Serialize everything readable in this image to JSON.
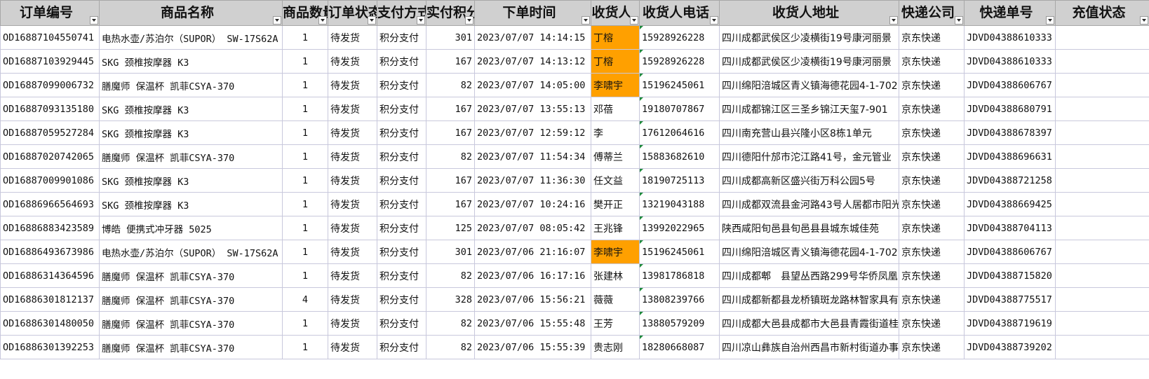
{
  "headers": {
    "order_no": "订单编号",
    "product": "商品名称",
    "qty": "商品数量",
    "status": "订单状态",
    "pay": "支付方式",
    "points": "实付积分",
    "time": "下单时间",
    "name": "收货人",
    "phone": "收货人电话",
    "addr": "收货人地址",
    "courier": "快递公司",
    "tracking": "快递单号",
    "recharge": "充值状态"
  },
  "highlight_color": "#ffa000",
  "rows": [
    {
      "order_no": "OD16887104550741",
      "product": "电热水壶/苏泊尔（SUPOR） SW-17S62A",
      "qty": "1",
      "status": "待发货",
      "pay": "积分支付",
      "points": "301",
      "time": "2023/07/07 14:14:15",
      "name": "丁榕",
      "phone": "15928926228",
      "addr": "四川成都武侯区少凌横街19号康河丽景",
      "courier": "京东快递",
      "tracking": "JDVD04388610333",
      "recharge": "",
      "highlight": true
    },
    {
      "order_no": "OD16887103929445",
      "product": "SKG 颈椎按摩器 K3",
      "qty": "1",
      "status": "待发货",
      "pay": "积分支付",
      "points": "167",
      "time": "2023/07/07 14:13:12",
      "name": "丁榕",
      "phone": "15928926228",
      "addr": "四川成都武侯区少凌横街19号康河丽景",
      "courier": "京东快递",
      "tracking": "JDVD04388610333",
      "recharge": "",
      "highlight": true
    },
    {
      "order_no": "OD16887099006732",
      "product": "膳魔师 保温杯 凯菲CSYA-370",
      "qty": "1",
      "status": "待发货",
      "pay": "积分支付",
      "points": "82",
      "time": "2023/07/07 14:05:00",
      "name": "李啸宇",
      "phone": "15196245061",
      "addr": "四川绵阳涪城区青义镇海德花园4-1-702",
      "courier": "京东快递",
      "tracking": "JDVD04388606767",
      "recharge": "",
      "highlight": true
    },
    {
      "order_no": "OD16887093135180",
      "product": "SKG 颈椎按摩器 K3",
      "qty": "1",
      "status": "待发货",
      "pay": "积分支付",
      "points": "167",
      "time": "2023/07/07 13:55:13",
      "name": "邓蓓",
      "phone": "19180707867",
      "addr": "四川成都锦江区三圣乡锦江天玺7-901",
      "courier": "京东快递",
      "tracking": "JDVD04388680791",
      "recharge": "",
      "highlight": false
    },
    {
      "order_no": "OD16887059527284",
      "product": "SKG 颈椎按摩器 K3",
      "qty": "1",
      "status": "待发货",
      "pay": "积分支付",
      "points": "167",
      "time": "2023/07/07 12:59:12",
      "name": "李",
      "phone": "17612064616",
      "addr": "四川南充营山县兴隆小区8栋1单元",
      "courier": "京东快递",
      "tracking": "JDVD04388678397",
      "recharge": "",
      "highlight": false
    },
    {
      "order_no": "OD16887020742065",
      "product": "膳魔师 保温杯 凯菲CSYA-370",
      "qty": "1",
      "status": "待发货",
      "pay": "积分支付",
      "points": "82",
      "time": "2023/07/07 11:54:34",
      "name": "傅蒂兰",
      "phone": "15883682610",
      "addr": "四川德阳什邡市沱江路41号，金元管业",
      "courier": "京东快递",
      "tracking": "JDVD04388696631",
      "recharge": "",
      "highlight": false
    },
    {
      "order_no": "OD16887009901086",
      "product": "SKG 颈椎按摩器 K3",
      "qty": "1",
      "status": "待发货",
      "pay": "积分支付",
      "points": "167",
      "time": "2023/07/07 11:36:30",
      "name": "任文益",
      "phone": "18190725113",
      "addr": "四川成都高新区盛兴街万科公园5号",
      "courier": "京东快递",
      "tracking": "JDVD04388721258",
      "recharge": "",
      "highlight": false
    },
    {
      "order_no": "OD16886966564693",
      "product": "SKG 颈椎按摩器 K3",
      "qty": "1",
      "status": "待发货",
      "pay": "积分支付",
      "points": "167",
      "time": "2023/07/07 10:24:16",
      "name": "樊开正",
      "phone": "13219043188",
      "addr": "四川成都双流县金河路43号人居都市阳光",
      "courier": "京东快递",
      "tracking": "JDVD04388669425",
      "recharge": "",
      "highlight": false
    },
    {
      "order_no": "OD16886883423589",
      "product": "博皓 便携式冲牙器 5025",
      "qty": "1",
      "status": "待发货",
      "pay": "积分支付",
      "points": "125",
      "time": "2023/07/07 08:05:42",
      "name": "王兆锋",
      "phone": "13992022965",
      "addr": "陕西咸阳旬邑县旬邑县县城东城佳苑",
      "courier": "京东快递",
      "tracking": "JDVD04388704113",
      "recharge": "",
      "highlight": false
    },
    {
      "order_no": "OD16886493673986",
      "product": "电热水壶/苏泊尔（SUPOR） SW-17S62A",
      "qty": "1",
      "status": "待发货",
      "pay": "积分支付",
      "points": "301",
      "time": "2023/07/06 21:16:07",
      "name": "李啸宇",
      "phone": "15196245061",
      "addr": "四川绵阳涪城区青义镇海德花园4-1-702",
      "courier": "京东快递",
      "tracking": "JDVD04388606767",
      "recharge": "",
      "highlight": true
    },
    {
      "order_no": "OD16886314364596",
      "product": "膳魔师 保温杯 凯菲CSYA-370",
      "qty": "1",
      "status": "待发货",
      "pay": "积分支付",
      "points": "82",
      "time": "2023/07/06 16:17:16",
      "name": "张建林",
      "phone": "13981786818",
      "addr": "四川成都郫　县望丛西路299号华侨凤凰",
      "courier": "京东快递",
      "tracking": "JDVD04388715820",
      "recharge": "",
      "highlight": false
    },
    {
      "order_no": "OD16886301812137",
      "product": "膳魔师 保温杯 凯菲CSYA-370",
      "qty": "4",
      "status": "待发货",
      "pay": "积分支付",
      "points": "328",
      "time": "2023/07/06 15:56:21",
      "name": "薇薇",
      "phone": "13808239766",
      "addr": "四川成都新都县龙桥镇斑龙路林智家具有",
      "courier": "京东快递",
      "tracking": "JDVD04388775517",
      "recharge": "",
      "highlight": false
    },
    {
      "order_no": "OD16886301480050",
      "product": "膳魔师 保温杯 凯菲CSYA-370",
      "qty": "1",
      "status": "待发货",
      "pay": "积分支付",
      "points": "82",
      "time": "2023/07/06 15:55:48",
      "name": "王芳",
      "phone": "13880579209",
      "addr": "四川成都大邑县成都市大邑县青霞街道桂",
      "courier": "京东快递",
      "tracking": "JDVD04388719619",
      "recharge": "",
      "highlight": false
    },
    {
      "order_no": "OD16886301392253",
      "product": "膳魔师 保温杯 凯菲CSYA-370",
      "qty": "1",
      "status": "待发货",
      "pay": "积分支付",
      "points": "82",
      "time": "2023/07/06 15:55:39",
      "name": "贵志刚",
      "phone": "18280668087",
      "addr": "四川凉山彝族自治州西昌市新村街道办事",
      "courier": "京东快递",
      "tracking": "JDVD04388739202",
      "recharge": "",
      "highlight": false
    }
  ]
}
